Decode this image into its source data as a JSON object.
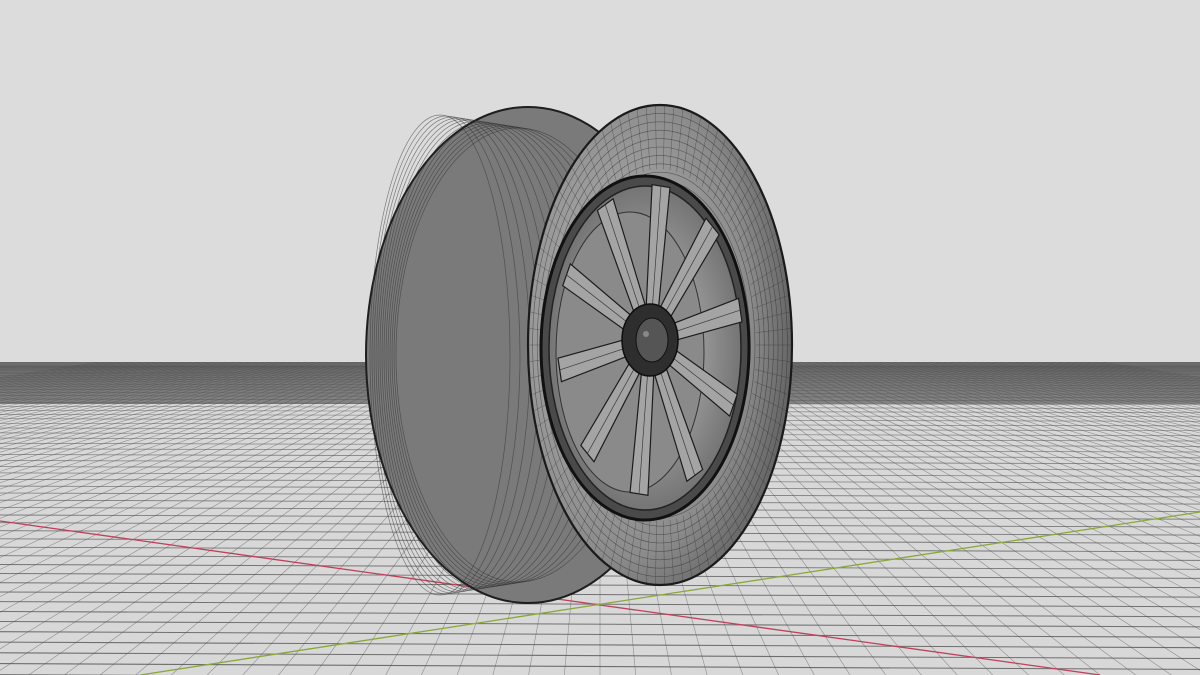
{
  "viewport": {
    "background": "#dcdcdc",
    "horizon_band": "#707070",
    "ground": "#d8d8d8",
    "grid_line": "#505050",
    "x_axis_color": "#c0405a",
    "y_axis_color": "#8aa838",
    "grid_visible": true
  },
  "model": {
    "object": "wheel",
    "display_mode": "wireframe-on-shaded",
    "tire_color": "#8e8e8e",
    "wire_color": "#2c2c2c",
    "rim_color": "#9a9a9a",
    "spoke_count": 10
  }
}
